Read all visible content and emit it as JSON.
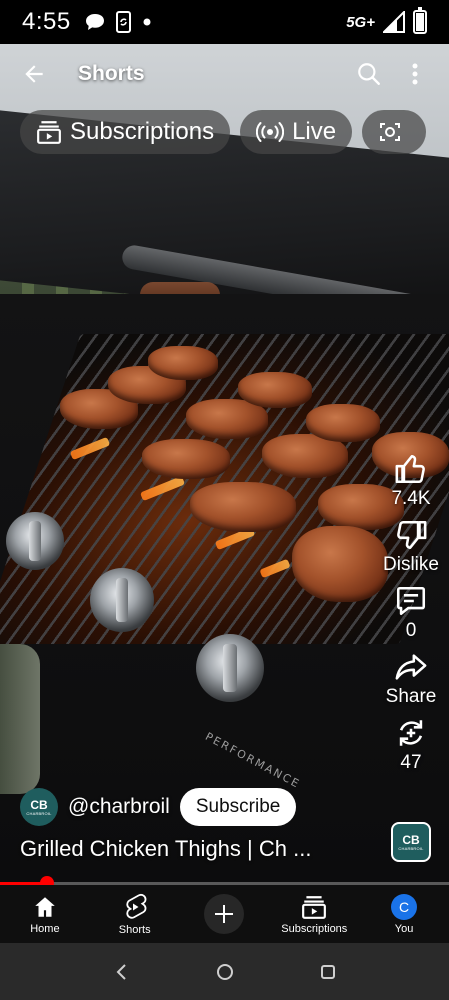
{
  "status_bar": {
    "time": "4:55",
    "network": "5G+",
    "icons": [
      "chat-bubble-icon",
      "phone-sync-icon",
      "dot-icon",
      "signal-icon",
      "battery-icon"
    ]
  },
  "topbar": {
    "title": "Shorts",
    "back_icon": "arrow-left-icon",
    "search_icon": "search-icon",
    "more_icon": "more-vert-icon"
  },
  "chips": [
    {
      "label": "Subscriptions",
      "icon": "subscriptions-icon"
    },
    {
      "label": "Live",
      "icon": "live-icon"
    },
    {
      "label": "",
      "icon": "lens-icon"
    }
  ],
  "actions": {
    "like_count": "7.4K",
    "dislike_label": "Dislike",
    "comments_count": "0",
    "share_label": "Share",
    "remix_count": "47"
  },
  "channel": {
    "avatar_mark": "CB",
    "avatar_sub": "CHARBROIL",
    "handle": "@charbroil",
    "subscribe_label": "Subscribe"
  },
  "video": {
    "title": "Grilled Chicken Thighs | Ch ...",
    "grill_text": "PERFORMANCE",
    "progress": 0.105
  },
  "bottom_nav": [
    {
      "label": "Home",
      "icon": "home-icon",
      "active": true
    },
    {
      "label": "Shorts",
      "icon": "shorts-icon",
      "active": false
    },
    {
      "label": "",
      "icon": "plus-icon",
      "active": false
    },
    {
      "label": "Subscriptions",
      "icon": "subscriptions-icon",
      "active": false
    },
    {
      "label": "You",
      "icon": "avatar",
      "avatar_letter": "C",
      "active": false
    }
  ],
  "colors": {
    "accent_red": "#ff0000",
    "avatar_blue": "#1a73e8",
    "brand_teal": "#1f5d5e"
  }
}
